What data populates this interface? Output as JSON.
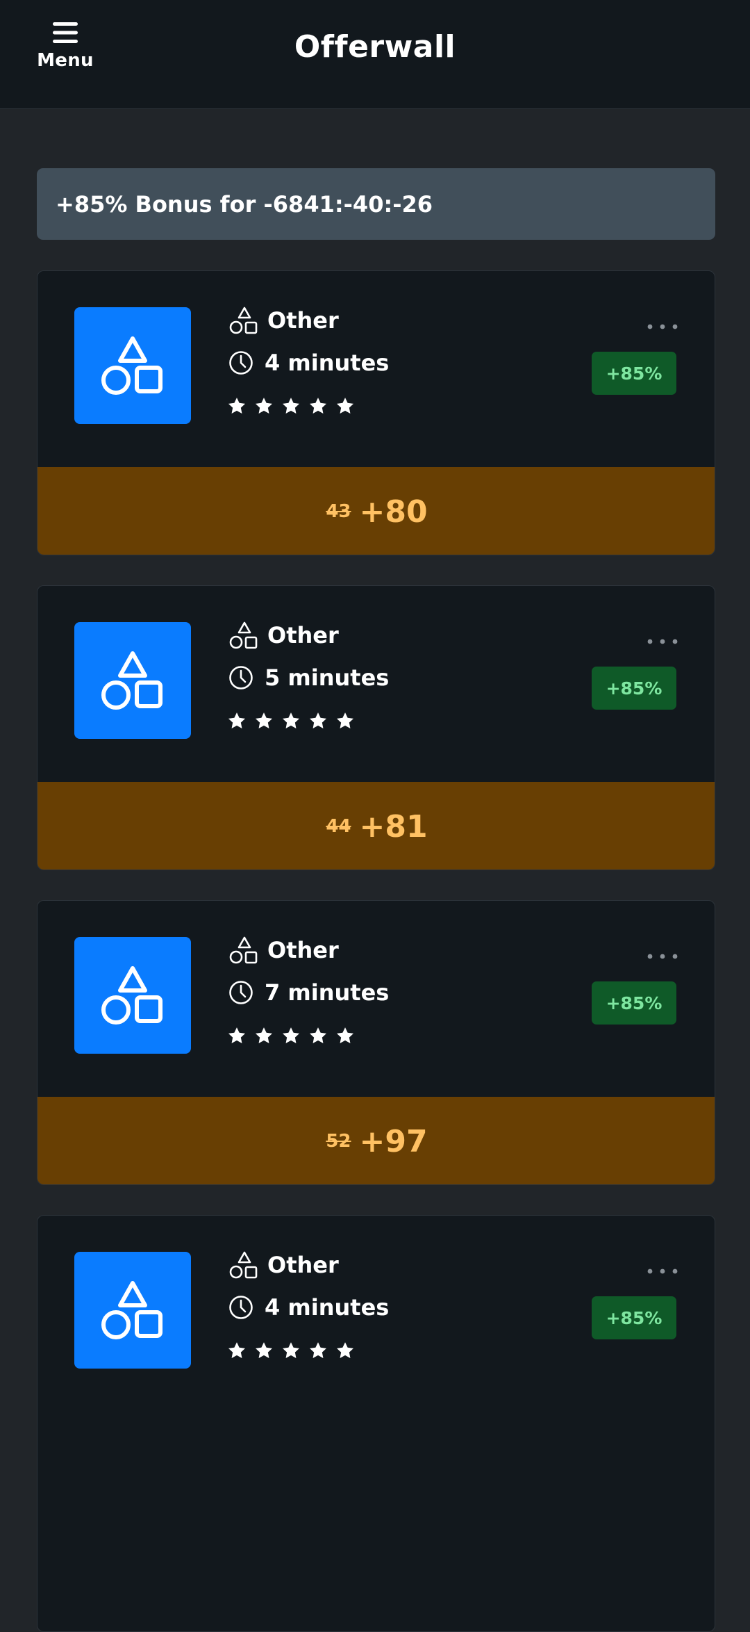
{
  "header": {
    "menu_label": "Menu",
    "title": "Offerwall"
  },
  "bonus_banner": {
    "text": "+85% Bonus for -6841:-40:-26"
  },
  "offers": [
    {
      "category": "Other",
      "duration": "4 minutes",
      "rating": 5,
      "badge": "+85%",
      "old_reward": "43",
      "new_reward": "+80"
    },
    {
      "category": "Other",
      "duration": "5 minutes",
      "rating": 5,
      "badge": "+85%",
      "old_reward": "44",
      "new_reward": "+81"
    },
    {
      "category": "Other",
      "duration": "7 minutes",
      "rating": 5,
      "badge": "+85%",
      "old_reward": "52",
      "new_reward": "+97"
    },
    {
      "category": "Other",
      "duration": "4 minutes",
      "rating": 5,
      "badge": "+85%"
    }
  ],
  "icons": {
    "menu": "hamburger-icon",
    "thumbnail": "shapes-icon",
    "category": "shapes-icon",
    "duration": "clock-icon",
    "rating": "star-icon",
    "more": "more-dots-icon"
  },
  "colors": {
    "page_bg": "#212529",
    "header_bg": "#12181d",
    "banner_bg": "#414f5a",
    "card_bg": "#12181d",
    "thumb_bg": "#0a7cff",
    "badge_bg": "#0f5a28",
    "badge_text": "#7ee6a0",
    "reward_bg": "#683f03",
    "reward_text": "#ffc163"
  }
}
